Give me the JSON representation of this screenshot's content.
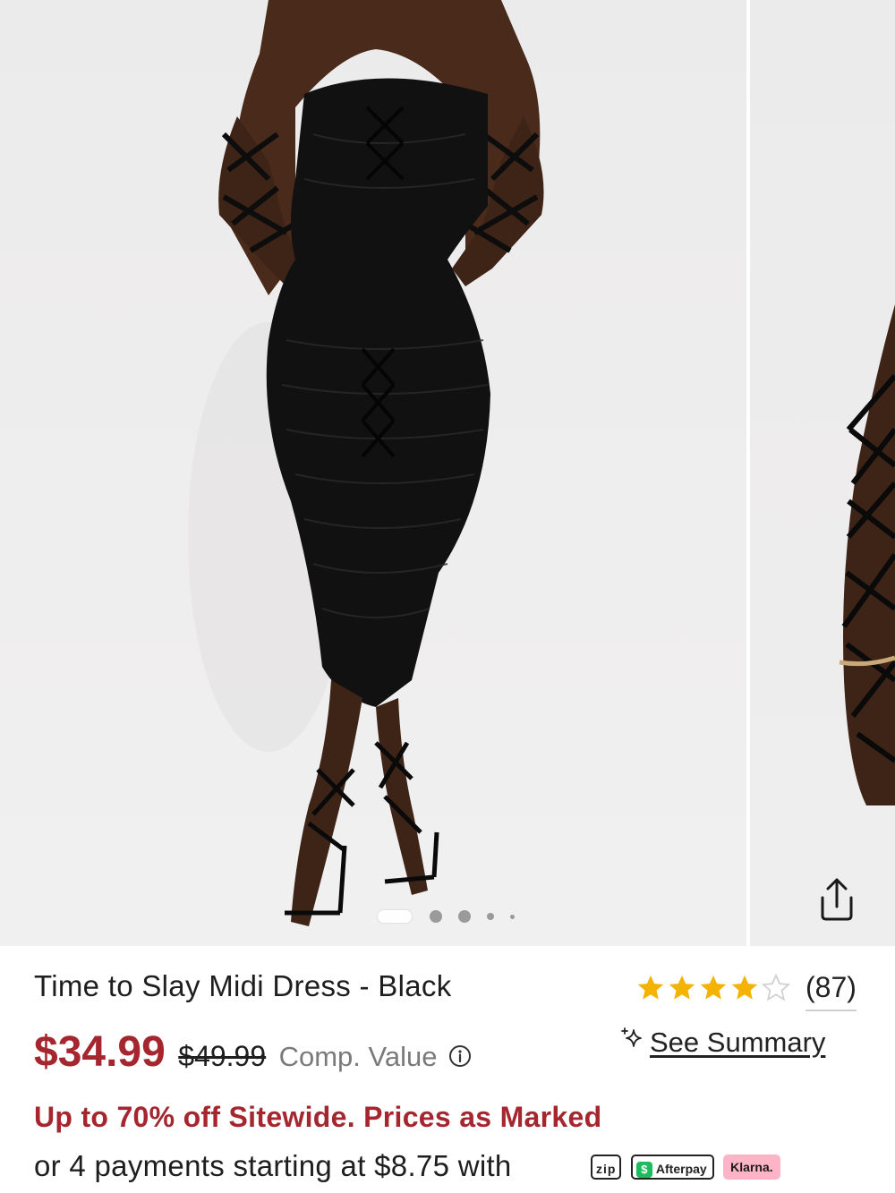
{
  "gallery": {
    "image_alt": "Model wearing black ruched off-shoulder lace-up midi dress",
    "slides_count": 5,
    "active_slide": 1
  },
  "product": {
    "title": "Time to Slay Midi Dress - Black",
    "price": "$34.99",
    "original_price": "$49.99",
    "comp_value_label": "Comp. Value"
  },
  "rating": {
    "stars": 4,
    "max_stars": 5,
    "review_count": "(87)"
  },
  "summary": {
    "label": "See Summary"
  },
  "promo": {
    "text": "Up to 70% off Sitewide. Prices as Marked"
  },
  "payments": {
    "text": "or 4 payments starting at $8.75 with",
    "providers": [
      "zip",
      "Afterpay",
      "Klarna."
    ]
  },
  "colors": {
    "price": "#a5262f",
    "star": "#f5b301",
    "dress": "#111111"
  },
  "icons": {
    "share": "share-icon",
    "info": "info-icon",
    "sparkle": "sparkle-icon"
  }
}
